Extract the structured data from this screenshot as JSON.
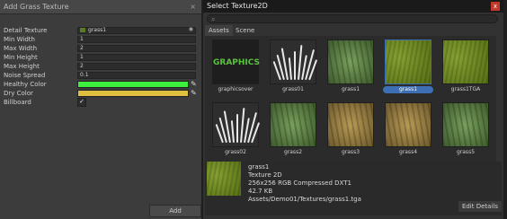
{
  "left_panel": {
    "title": "Add Grass Texture",
    "close_glyph": "×",
    "fields": [
      {
        "label": "Detail Texture",
        "value": "grass1"
      },
      {
        "label": "Min Width",
        "value": "1"
      },
      {
        "label": "Max Width",
        "value": "2"
      },
      {
        "label": "Min Height",
        "value": "1"
      },
      {
        "label": "Max Height",
        "value": "2"
      },
      {
        "label": "Noise Spread",
        "value": "0.1"
      },
      {
        "label": "Healthy Color",
        "color": "#3ef03e"
      },
      {
        "label": "Dry Color",
        "color": "#e0c040"
      },
      {
        "label": "Billboard",
        "checked": "✓"
      }
    ],
    "add_label": "Add"
  },
  "right_panel": {
    "title": "Select Texture2D",
    "close_glyph": "x",
    "search_icon": "search-icon",
    "search_glyph": "⌕",
    "tabs": [
      {
        "label": "Assets"
      },
      {
        "label": "Scene"
      }
    ],
    "assets": [
      {
        "name": "graphicsover",
        "thumb": "graphics",
        "thumb_text": "GRAPHICS"
      },
      {
        "name": "grass01",
        "thumb": "white-grass"
      },
      {
        "name": "grass1",
        "thumb": "green"
      },
      {
        "name": "grass1",
        "thumb": "grass",
        "selected": true
      },
      {
        "name": "grass1TGA",
        "thumb": "grass"
      },
      {
        "name": "grass02",
        "thumb": "white-grass"
      },
      {
        "name": "grass2",
        "thumb": "green"
      },
      {
        "name": "grass3",
        "thumb": "dry"
      },
      {
        "name": "grass4",
        "thumb": "dry"
      },
      {
        "name": "grass5",
        "thumb": "green"
      }
    ],
    "info": {
      "name": "grass1",
      "type": "Texture 2D",
      "format": "256x256  RGB Compressed DXT1",
      "size": "42.7 KB",
      "path": "Assets/Demo01/Textures/grass1.tga",
      "edit_label": "Edit Details"
    }
  }
}
